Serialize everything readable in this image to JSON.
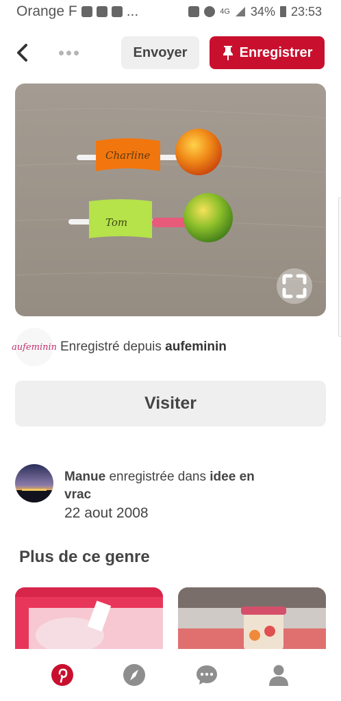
{
  "status_bar": {
    "carrier": "Orange F",
    "ellipsis": "...",
    "network": "4G",
    "battery": "34%",
    "time": "23:53"
  },
  "header": {
    "send_label": "Envoyer",
    "save_label": "Enregistrer"
  },
  "pin": {
    "tags": [
      "Charline",
      "Tom"
    ]
  },
  "source": {
    "avatar_text": "aufeminin",
    "prefix": "Enregistré depuis ",
    "name": "aufeminin"
  },
  "visit_label": "Visiter",
  "saver": {
    "name": "Manue",
    "action": " enregistrée dans ",
    "board": "idee en vrac",
    "date": "22 aout 2008"
  },
  "more_section": {
    "title": "Plus de ce genre"
  },
  "colors": {
    "brand_red": "#c8102e",
    "button_gray": "#efefef",
    "nav_gray": "#8e8e8e"
  },
  "nav": [
    "home-icon",
    "explore-icon",
    "messages-icon",
    "profile-icon"
  ]
}
